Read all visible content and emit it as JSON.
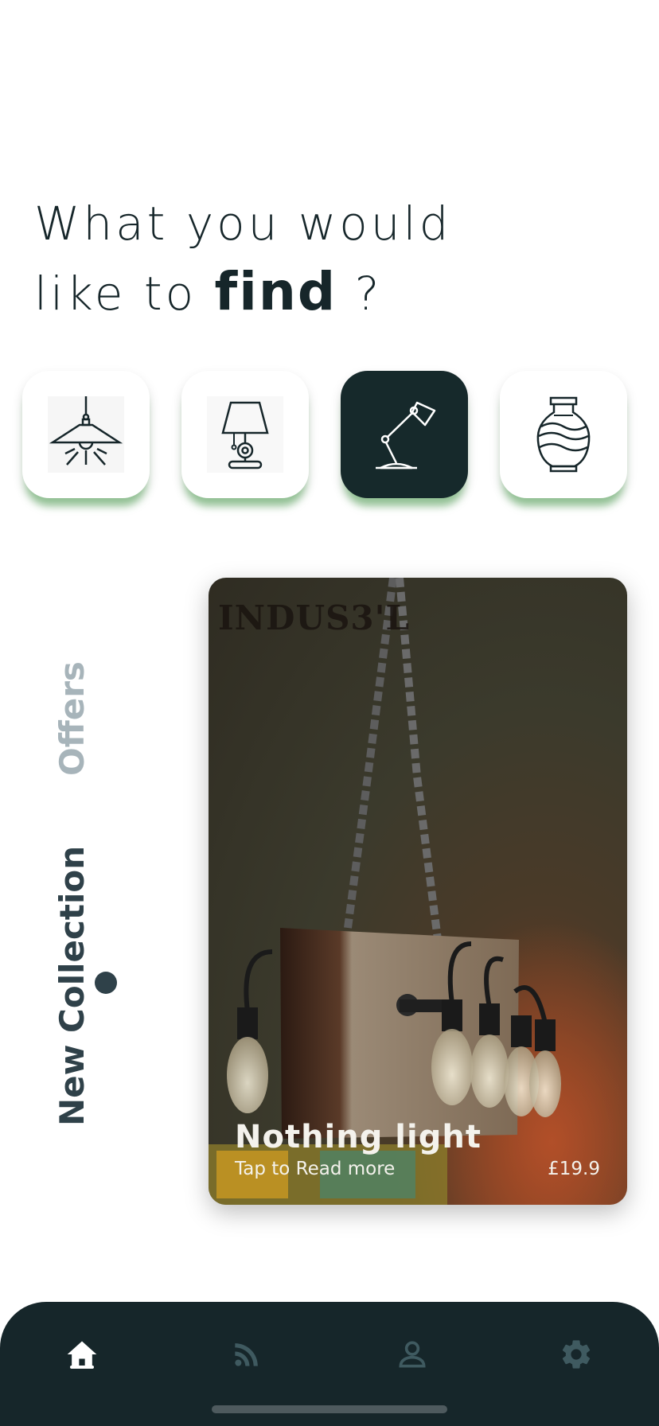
{
  "headline": {
    "line1": "What you would",
    "line2_prefix": "like to",
    "line2_bold": "find",
    "line2_suffix": "?"
  },
  "categories": [
    {
      "icon": "pendant-lamp-icon",
      "active": false
    },
    {
      "icon": "table-lamp-icon",
      "active": false
    },
    {
      "icon": "desk-lamp-icon",
      "active": true
    },
    {
      "icon": "vase-icon",
      "active": false
    }
  ],
  "tabs": {
    "offers": "Offers",
    "new_collection": "New Collection",
    "active": "new_collection"
  },
  "card": {
    "brand": "INDUS3'L",
    "title": "Nothing light",
    "subtitle": "Tap to Read more",
    "price": "£19.9"
  },
  "nav": {
    "items": [
      {
        "icon": "home-icon",
        "active": true
      },
      {
        "icon": "rss-feed-icon",
        "active": false
      },
      {
        "icon": "profile-icon",
        "active": false
      },
      {
        "icon": "settings-gear-icon",
        "active": false
      }
    ]
  },
  "colors": {
    "primary_dark": "#16262a",
    "accent_green_shadow": "#4ca050",
    "muted_tab": "#a7b4ba",
    "active_tab": "#2f4149",
    "nav_inactive_icon": "#3f5a60"
  }
}
